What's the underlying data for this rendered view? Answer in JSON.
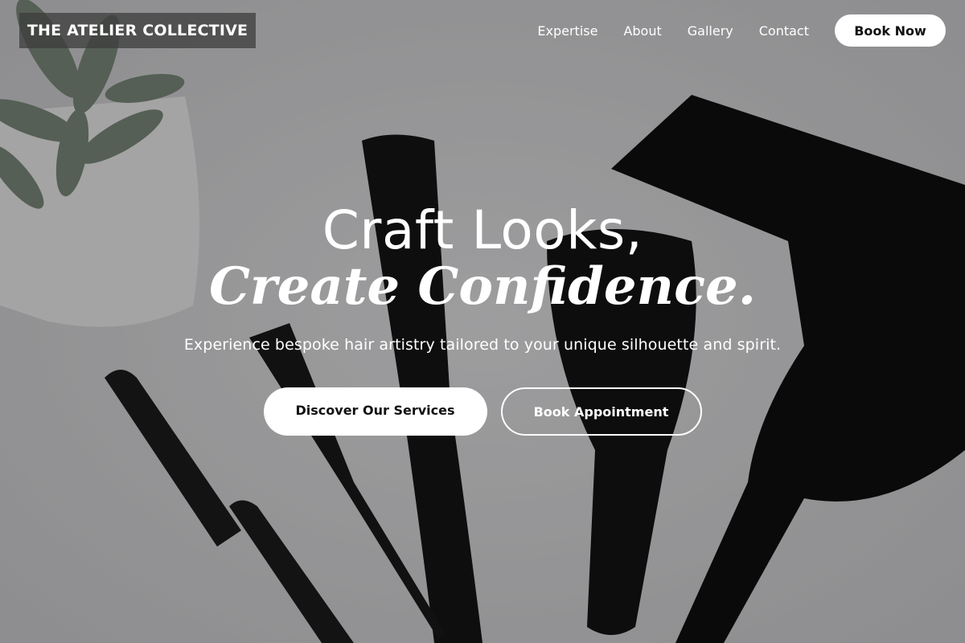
{
  "brand": {
    "name": "THE ATELIER COLLECTIVE"
  },
  "nav": {
    "links": [
      "Expertise",
      "About",
      "Gallery",
      "Contact"
    ],
    "book_label": "Book Now"
  },
  "hero": {
    "headline_line1": "Craft Looks,",
    "headline_line2": "Create Confidence.",
    "subtitle": "Experience bespoke hair artistry tailored to your unique silhouette and spirit.",
    "primary_cta": "Discover Our Services",
    "secondary_cta": "Book Appointment",
    "background_image": "hair-styling-tools-photo"
  },
  "colors": {
    "overlay": "#000000",
    "button_fill": "#ffffff",
    "button_text": "#111111",
    "text": "#ffffff"
  }
}
